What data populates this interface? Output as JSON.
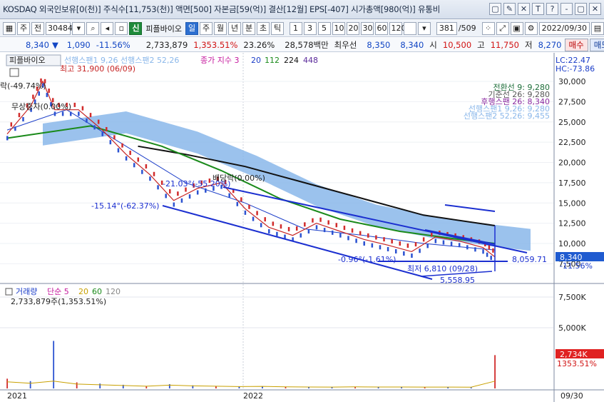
{
  "title_bar": {
    "text": "KOSDAQ 외국인보유[0(천)] 주식수[11,753(천)] 액면[500] 자본금[59(억)] 결산[12월] EPS[-407] 시가총액[980(억)] 유통비",
    "buttons": [
      "▢",
      "✎",
      "✕",
      "T",
      "?",
      "-",
      "▢",
      "✕"
    ]
  },
  "toolbar": {
    "period_unit": "주",
    "prev_label": "전",
    "stock_code": "304840",
    "stock_badge": "신",
    "stock_name": "피플바이오",
    "period_tabs": [
      "일",
      "주",
      "월",
      "년",
      "분",
      "초",
      "틱"
    ],
    "selected_tab": "일",
    "interval_buttons": [
      "1",
      "3",
      "5",
      "10",
      "20",
      "30",
      "60",
      "120"
    ],
    "page_position": "381",
    "page_total": "/509",
    "date": "2022/09/30"
  },
  "quote": {
    "price": "8,340",
    "change_arrow": "▼",
    "change": "1,090",
    "change_pct": "-11.56%",
    "volume": "2,733,879",
    "volume_ratio": "1,353.51%",
    "turnover": "23.26%",
    "amount": "28,578백만",
    "best_ask_label": "최우선",
    "best_ask": "8,350",
    "best_bid": "8,340",
    "open_label": "시",
    "open": "10,500",
    "high_label": "고",
    "high": "11,750",
    "low_label": "저",
    "low": "8,270",
    "buy_label": "매수",
    "sell_label": "매도"
  },
  "price_panel": {
    "header_name": "피플바이오",
    "legend_ichimoku": "선행스팬1 9,26  선행스팬2 52,26",
    "legend_ma_label": "종가 지수 3",
    "ma_periods": [
      "20",
      "112",
      "224",
      "448"
    ],
    "ma_colors": [
      "#1a3cc8",
      "#1a8a1a",
      "#111111",
      "#5a2a9a"
    ],
    "lc": "LC:22.47",
    "hc": "HC:-73.86",
    "ichimoku_legend": [
      {
        "text": "전환선 9: 9,280",
        "color": "#1d6e3a"
      },
      {
        "text": "기준선 26: 9,280",
        "color": "#555555"
      },
      {
        "text": "후행스팬 26: 8,340",
        "color": "#8a2aa0"
      },
      {
        "text": "선행스팬1 9,26: 9,280",
        "color": "#8ab7ea"
      },
      {
        "text": "선행스팬2 52,26: 9,455",
        "color": "#8ab7ea"
      }
    ],
    "y_ticks": [
      "30,000",
      "27,500",
      "25,000",
      "22,500",
      "20,000",
      "17,500",
      "15,000",
      "12,500",
      "10,000",
      "7,500"
    ],
    "last_price_tag": "8,340",
    "last_pct_tag": "-11.56%",
    "annotations": {
      "high": "최고 31,900 (06/09)",
      "rights_drop": "락(-49.74%)",
      "bonus_issue": "무상증자(0.00%)",
      "dividend": "배당락(0.00%)",
      "channel_a": "-21.03°(-55.20%)",
      "channel_b": "-15.14°(-62.37%)",
      "channel_c": "-0.96°(-1.61%)",
      "low": "최저 6,810 (09/28)",
      "level_a": "8,059.71",
      "level_b": "5,558.95"
    }
  },
  "volume_panel": {
    "label": "거래량",
    "ma_label": "단순 5",
    "ma_periods": [
      "20",
      "60",
      "120"
    ],
    "ma_colors": [
      "#c8a000",
      "#1a8a1a",
      "#888888"
    ],
    "value": "2,733,879주(1,353.51%)",
    "y_ticks": [
      "7,500K",
      "5,000K"
    ],
    "last_tag": "2,734K",
    "last_pct": "1353.51%"
  },
  "x_axis": {
    "labels": [
      "2021",
      "2022",
      "09/30"
    ]
  },
  "chart_data": {
    "type": "line",
    "title": "",
    "x_range": [
      "2021-01",
      "2022-09-30"
    ],
    "ylim": [
      6500,
      31900
    ],
    "series": [
      {
        "name": "종가",
        "points": [
          [
            0,
            23500
          ],
          [
            4,
            27000
          ],
          [
            6,
            30000
          ],
          [
            8,
            26500
          ],
          [
            12,
            26500
          ],
          [
            16,
            24000
          ],
          [
            20,
            21000
          ],
          [
            24,
            18500
          ],
          [
            28,
            15300
          ],
          [
            32,
            16800
          ],
          [
            36,
            17500
          ],
          [
            40,
            14300
          ],
          [
            44,
            12000
          ],
          [
            48,
            11000
          ],
          [
            52,
            12500
          ],
          [
            56,
            11500
          ],
          [
            60,
            10500
          ],
          [
            64,
            9800
          ],
          [
            68,
            9000
          ],
          [
            72,
            10800
          ],
          [
            76,
            10300
          ],
          [
            80,
            9500
          ],
          [
            82,
            8340
          ]
        ]
      },
      {
        "name": "20",
        "points": [
          [
            0,
            24000
          ],
          [
            10,
            26500
          ],
          [
            20,
            22000
          ],
          [
            30,
            17500
          ],
          [
            40,
            15000
          ],
          [
            50,
            11800
          ],
          [
            60,
            11000
          ],
          [
            70,
            10000
          ],
          [
            82,
            9200
          ]
        ]
      },
      {
        "name": "112",
        "points": [
          [
            0,
            23000
          ],
          [
            14,
            24500
          ],
          [
            26,
            22000
          ],
          [
            36,
            19000
          ],
          [
            46,
            15500
          ],
          [
            56,
            13000
          ],
          [
            66,
            11500
          ],
          [
            76,
            10500
          ],
          [
            82,
            10000
          ]
        ]
      },
      {
        "name": "224",
        "points": [
          [
            22,
            22000
          ],
          [
            30,
            21000
          ],
          [
            40,
            19500
          ],
          [
            50,
            17500
          ],
          [
            60,
            15500
          ],
          [
            70,
            13500
          ],
          [
            82,
            12200
          ]
        ]
      }
    ],
    "volume": [
      {
        "name": "거래량",
        "values": [
          800,
          600,
          3900,
          500,
          400,
          300,
          200,
          350,
          250,
          200,
          150,
          180,
          120,
          100,
          90,
          110,
          95,
          100,
          85,
          90,
          80,
          2734
        ]
      }
    ]
  }
}
